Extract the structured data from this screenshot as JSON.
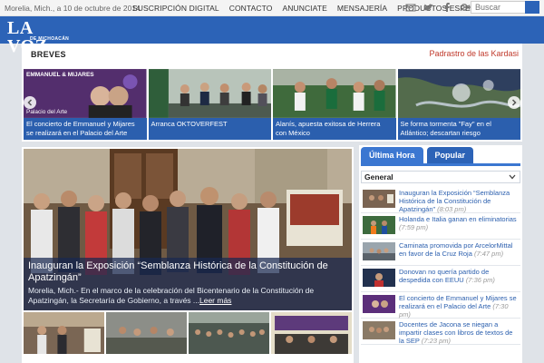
{
  "topbar": {
    "date": "Morelia, Mich., a 10 de octubre de 2014",
    "nav": [
      "SUSCRIPCIÓN DIGITAL",
      "CONTACTO",
      "ANUNCIATE",
      "MENSAJERÍA",
      "PRODUCTOS ESPECIALES"
    ],
    "search_placeholder": "Buscar"
  },
  "logo": {
    "main": "LA VOZ",
    "sub": "DE MICHOACÁN"
  },
  "breves": {
    "label": "BREVES",
    "ticker": "Padrastro de las Kardasi",
    "items": [
      "El concierto de Emmanuel y Mijares se realizará en el Palacio del Arte",
      "Arranca OKTOVERFEST",
      "Alanís, apuesta exitosa de Herrera con México",
      "Se forma tormenta \"Fay\" en el Atlántico; descartan riesgo"
    ],
    "poster_text": "EMMANUEL & MIJARES",
    "poster_place": "Palacio del Arte"
  },
  "hero": {
    "title": "Inauguran la Exposición “Semblanza Histórica de la Constitución de Apatzingán”",
    "excerpt": "Morelia, Mich.- En el marco de la celebración del Bicentenario de la Constitución de Apatzingán, la Secretaría de Gobierno, a través ...",
    "more": "Leer más"
  },
  "sidebar": {
    "tabs": [
      "Última Hora",
      "Popular"
    ],
    "select_value": "General",
    "items": [
      {
        "title": "Inauguran la Exposición “Semblanza Histórica de la Constitución de Apatzingán”",
        "time": "(8:03 pm)"
      },
      {
        "title": "Holanda e Italia ganan en eliminatorias",
        "time": "(7:59 pm)"
      },
      {
        "title": "Caminata promovida por ArcelorMittal en favor de la Cruz Roja",
        "time": "(7:47 pm)"
      },
      {
        "title": "Donovan no quería partido de despedida con EEUU",
        "time": "(7:36 pm)"
      },
      {
        "title": "El concierto de Emmanuel y Mijares se realizará en el Palacio del Arte",
        "time": "(7:30 pm)"
      },
      {
        "title": "Docentes de Jacona se niegan a impartir clases con libros de textos de la SEP",
        "time": "(7:23 pm)"
      }
    ]
  },
  "colors": {
    "brand": "#2c63b7",
    "caption": "#2b5fae",
    "ticker": "#c0392b"
  }
}
